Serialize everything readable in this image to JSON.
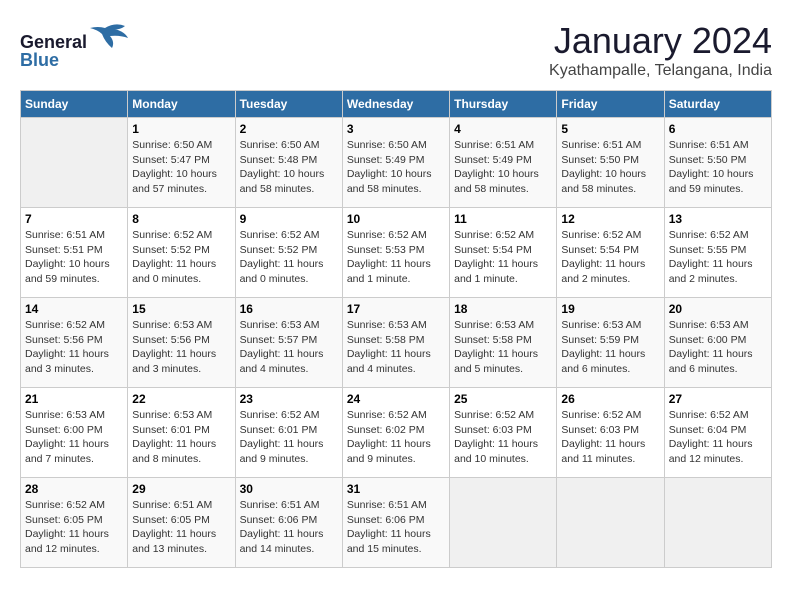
{
  "logo": {
    "line1": "General",
    "line2": "Blue"
  },
  "title": "January 2024",
  "location": "Kyathampalle, Telangana, India",
  "weekdays": [
    "Sunday",
    "Monday",
    "Tuesday",
    "Wednesday",
    "Thursday",
    "Friday",
    "Saturday"
  ],
  "weeks": [
    [
      {
        "day": "",
        "info": ""
      },
      {
        "day": "1",
        "info": "Sunrise: 6:50 AM\nSunset: 5:47 PM\nDaylight: 10 hours\nand 57 minutes."
      },
      {
        "day": "2",
        "info": "Sunrise: 6:50 AM\nSunset: 5:48 PM\nDaylight: 10 hours\nand 58 minutes."
      },
      {
        "day": "3",
        "info": "Sunrise: 6:50 AM\nSunset: 5:49 PM\nDaylight: 10 hours\nand 58 minutes."
      },
      {
        "day": "4",
        "info": "Sunrise: 6:51 AM\nSunset: 5:49 PM\nDaylight: 10 hours\nand 58 minutes."
      },
      {
        "day": "5",
        "info": "Sunrise: 6:51 AM\nSunset: 5:50 PM\nDaylight: 10 hours\nand 58 minutes."
      },
      {
        "day": "6",
        "info": "Sunrise: 6:51 AM\nSunset: 5:50 PM\nDaylight: 10 hours\nand 59 minutes."
      }
    ],
    [
      {
        "day": "7",
        "info": "Sunrise: 6:51 AM\nSunset: 5:51 PM\nDaylight: 10 hours\nand 59 minutes."
      },
      {
        "day": "8",
        "info": "Sunrise: 6:52 AM\nSunset: 5:52 PM\nDaylight: 11 hours\nand 0 minutes."
      },
      {
        "day": "9",
        "info": "Sunrise: 6:52 AM\nSunset: 5:52 PM\nDaylight: 11 hours\nand 0 minutes."
      },
      {
        "day": "10",
        "info": "Sunrise: 6:52 AM\nSunset: 5:53 PM\nDaylight: 11 hours\nand 1 minute."
      },
      {
        "day": "11",
        "info": "Sunrise: 6:52 AM\nSunset: 5:54 PM\nDaylight: 11 hours\nand 1 minute."
      },
      {
        "day": "12",
        "info": "Sunrise: 6:52 AM\nSunset: 5:54 PM\nDaylight: 11 hours\nand 2 minutes."
      },
      {
        "day": "13",
        "info": "Sunrise: 6:52 AM\nSunset: 5:55 PM\nDaylight: 11 hours\nand 2 minutes."
      }
    ],
    [
      {
        "day": "14",
        "info": "Sunrise: 6:52 AM\nSunset: 5:56 PM\nDaylight: 11 hours\nand 3 minutes."
      },
      {
        "day": "15",
        "info": "Sunrise: 6:53 AM\nSunset: 5:56 PM\nDaylight: 11 hours\nand 3 minutes."
      },
      {
        "day": "16",
        "info": "Sunrise: 6:53 AM\nSunset: 5:57 PM\nDaylight: 11 hours\nand 4 minutes."
      },
      {
        "day": "17",
        "info": "Sunrise: 6:53 AM\nSunset: 5:58 PM\nDaylight: 11 hours\nand 4 minutes."
      },
      {
        "day": "18",
        "info": "Sunrise: 6:53 AM\nSunset: 5:58 PM\nDaylight: 11 hours\nand 5 minutes."
      },
      {
        "day": "19",
        "info": "Sunrise: 6:53 AM\nSunset: 5:59 PM\nDaylight: 11 hours\nand 6 minutes."
      },
      {
        "day": "20",
        "info": "Sunrise: 6:53 AM\nSunset: 6:00 PM\nDaylight: 11 hours\nand 6 minutes."
      }
    ],
    [
      {
        "day": "21",
        "info": "Sunrise: 6:53 AM\nSunset: 6:00 PM\nDaylight: 11 hours\nand 7 minutes."
      },
      {
        "day": "22",
        "info": "Sunrise: 6:53 AM\nSunset: 6:01 PM\nDaylight: 11 hours\nand 8 minutes."
      },
      {
        "day": "23",
        "info": "Sunrise: 6:52 AM\nSunset: 6:01 PM\nDaylight: 11 hours\nand 9 minutes."
      },
      {
        "day": "24",
        "info": "Sunrise: 6:52 AM\nSunset: 6:02 PM\nDaylight: 11 hours\nand 9 minutes."
      },
      {
        "day": "25",
        "info": "Sunrise: 6:52 AM\nSunset: 6:03 PM\nDaylight: 11 hours\nand 10 minutes."
      },
      {
        "day": "26",
        "info": "Sunrise: 6:52 AM\nSunset: 6:03 PM\nDaylight: 11 hours\nand 11 minutes."
      },
      {
        "day": "27",
        "info": "Sunrise: 6:52 AM\nSunset: 6:04 PM\nDaylight: 11 hours\nand 12 minutes."
      }
    ],
    [
      {
        "day": "28",
        "info": "Sunrise: 6:52 AM\nSunset: 6:05 PM\nDaylight: 11 hours\nand 12 minutes."
      },
      {
        "day": "29",
        "info": "Sunrise: 6:51 AM\nSunset: 6:05 PM\nDaylight: 11 hours\nand 13 minutes."
      },
      {
        "day": "30",
        "info": "Sunrise: 6:51 AM\nSunset: 6:06 PM\nDaylight: 11 hours\nand 14 minutes."
      },
      {
        "day": "31",
        "info": "Sunrise: 6:51 AM\nSunset: 6:06 PM\nDaylight: 11 hours\nand 15 minutes."
      },
      {
        "day": "",
        "info": ""
      },
      {
        "day": "",
        "info": ""
      },
      {
        "day": "",
        "info": ""
      }
    ]
  ]
}
